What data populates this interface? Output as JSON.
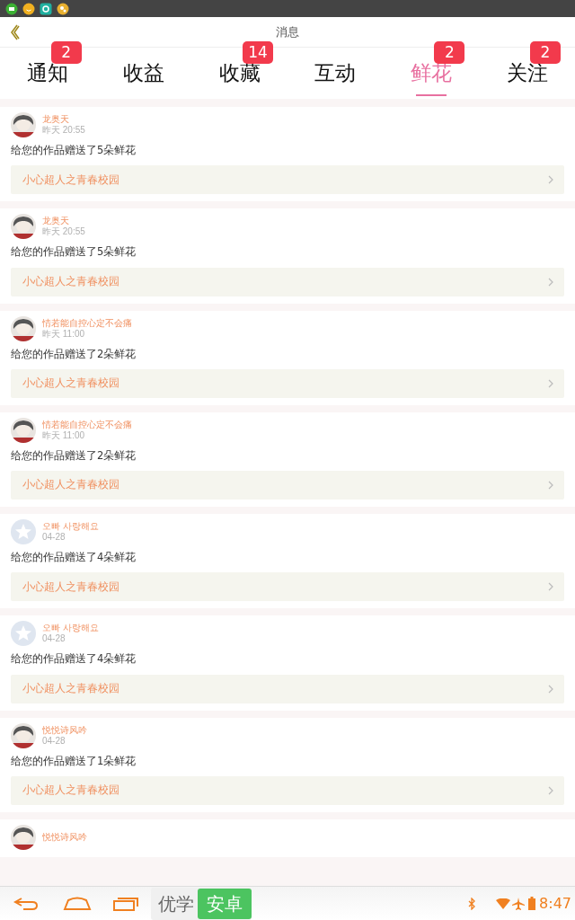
{
  "header": {
    "title": "消息"
  },
  "tabs": [
    {
      "label": "通知",
      "badge": "2",
      "selected": false
    },
    {
      "label": "收益",
      "selected": false
    },
    {
      "label": "收藏",
      "badge": "14",
      "selected": false
    },
    {
      "label": "互动",
      "selected": false
    },
    {
      "label": "鲜花",
      "badge": "2",
      "selected": true
    },
    {
      "label": "关注",
      "badge": "2",
      "selected": false
    }
  ],
  "messages": [
    {
      "user": "龙奥天",
      "time": "昨天 20:55",
      "text": "给您的作品赠送了5朵鲜花",
      "work": "小心超人之青春校园"
    },
    {
      "user": "龙奥天",
      "time": "昨天 20:55",
      "text": "给您的作品赠送了5朵鲜花",
      "work": "小心超人之青春校园"
    },
    {
      "user": "情若能自控心定不会痛",
      "time": "昨天 11:00",
      "text": "给您的作品赠送了2朵鲜花",
      "work": "小心超人之青春校园"
    },
    {
      "user": "情若能自控心定不会痛",
      "time": "昨天 11:00",
      "text": "给您的作品赠送了2朵鲜花",
      "work": "小心超人之青春校园"
    },
    {
      "kind": "default",
      "user": "오빠 사랑해요",
      "time": "04-28",
      "text": "给您的作品赠送了4朵鲜花",
      "work": "小心超人之青春校园"
    },
    {
      "kind": "default",
      "user": "오빠 사랑해요",
      "time": "04-28",
      "text": "给您的作品赠送了4朵鲜花",
      "work": "小心超人之青春校园"
    },
    {
      "user": "悦悦诗风吟",
      "time": "04-28",
      "text": "给您的作品赠送了1朵鲜花",
      "work": "小心超人之青春校园"
    },
    {
      "user": "悦悦诗风吟"
    }
  ],
  "nav_bar": {
    "apps": [
      "优学",
      "安卓"
    ],
    "clock": "8:47"
  }
}
